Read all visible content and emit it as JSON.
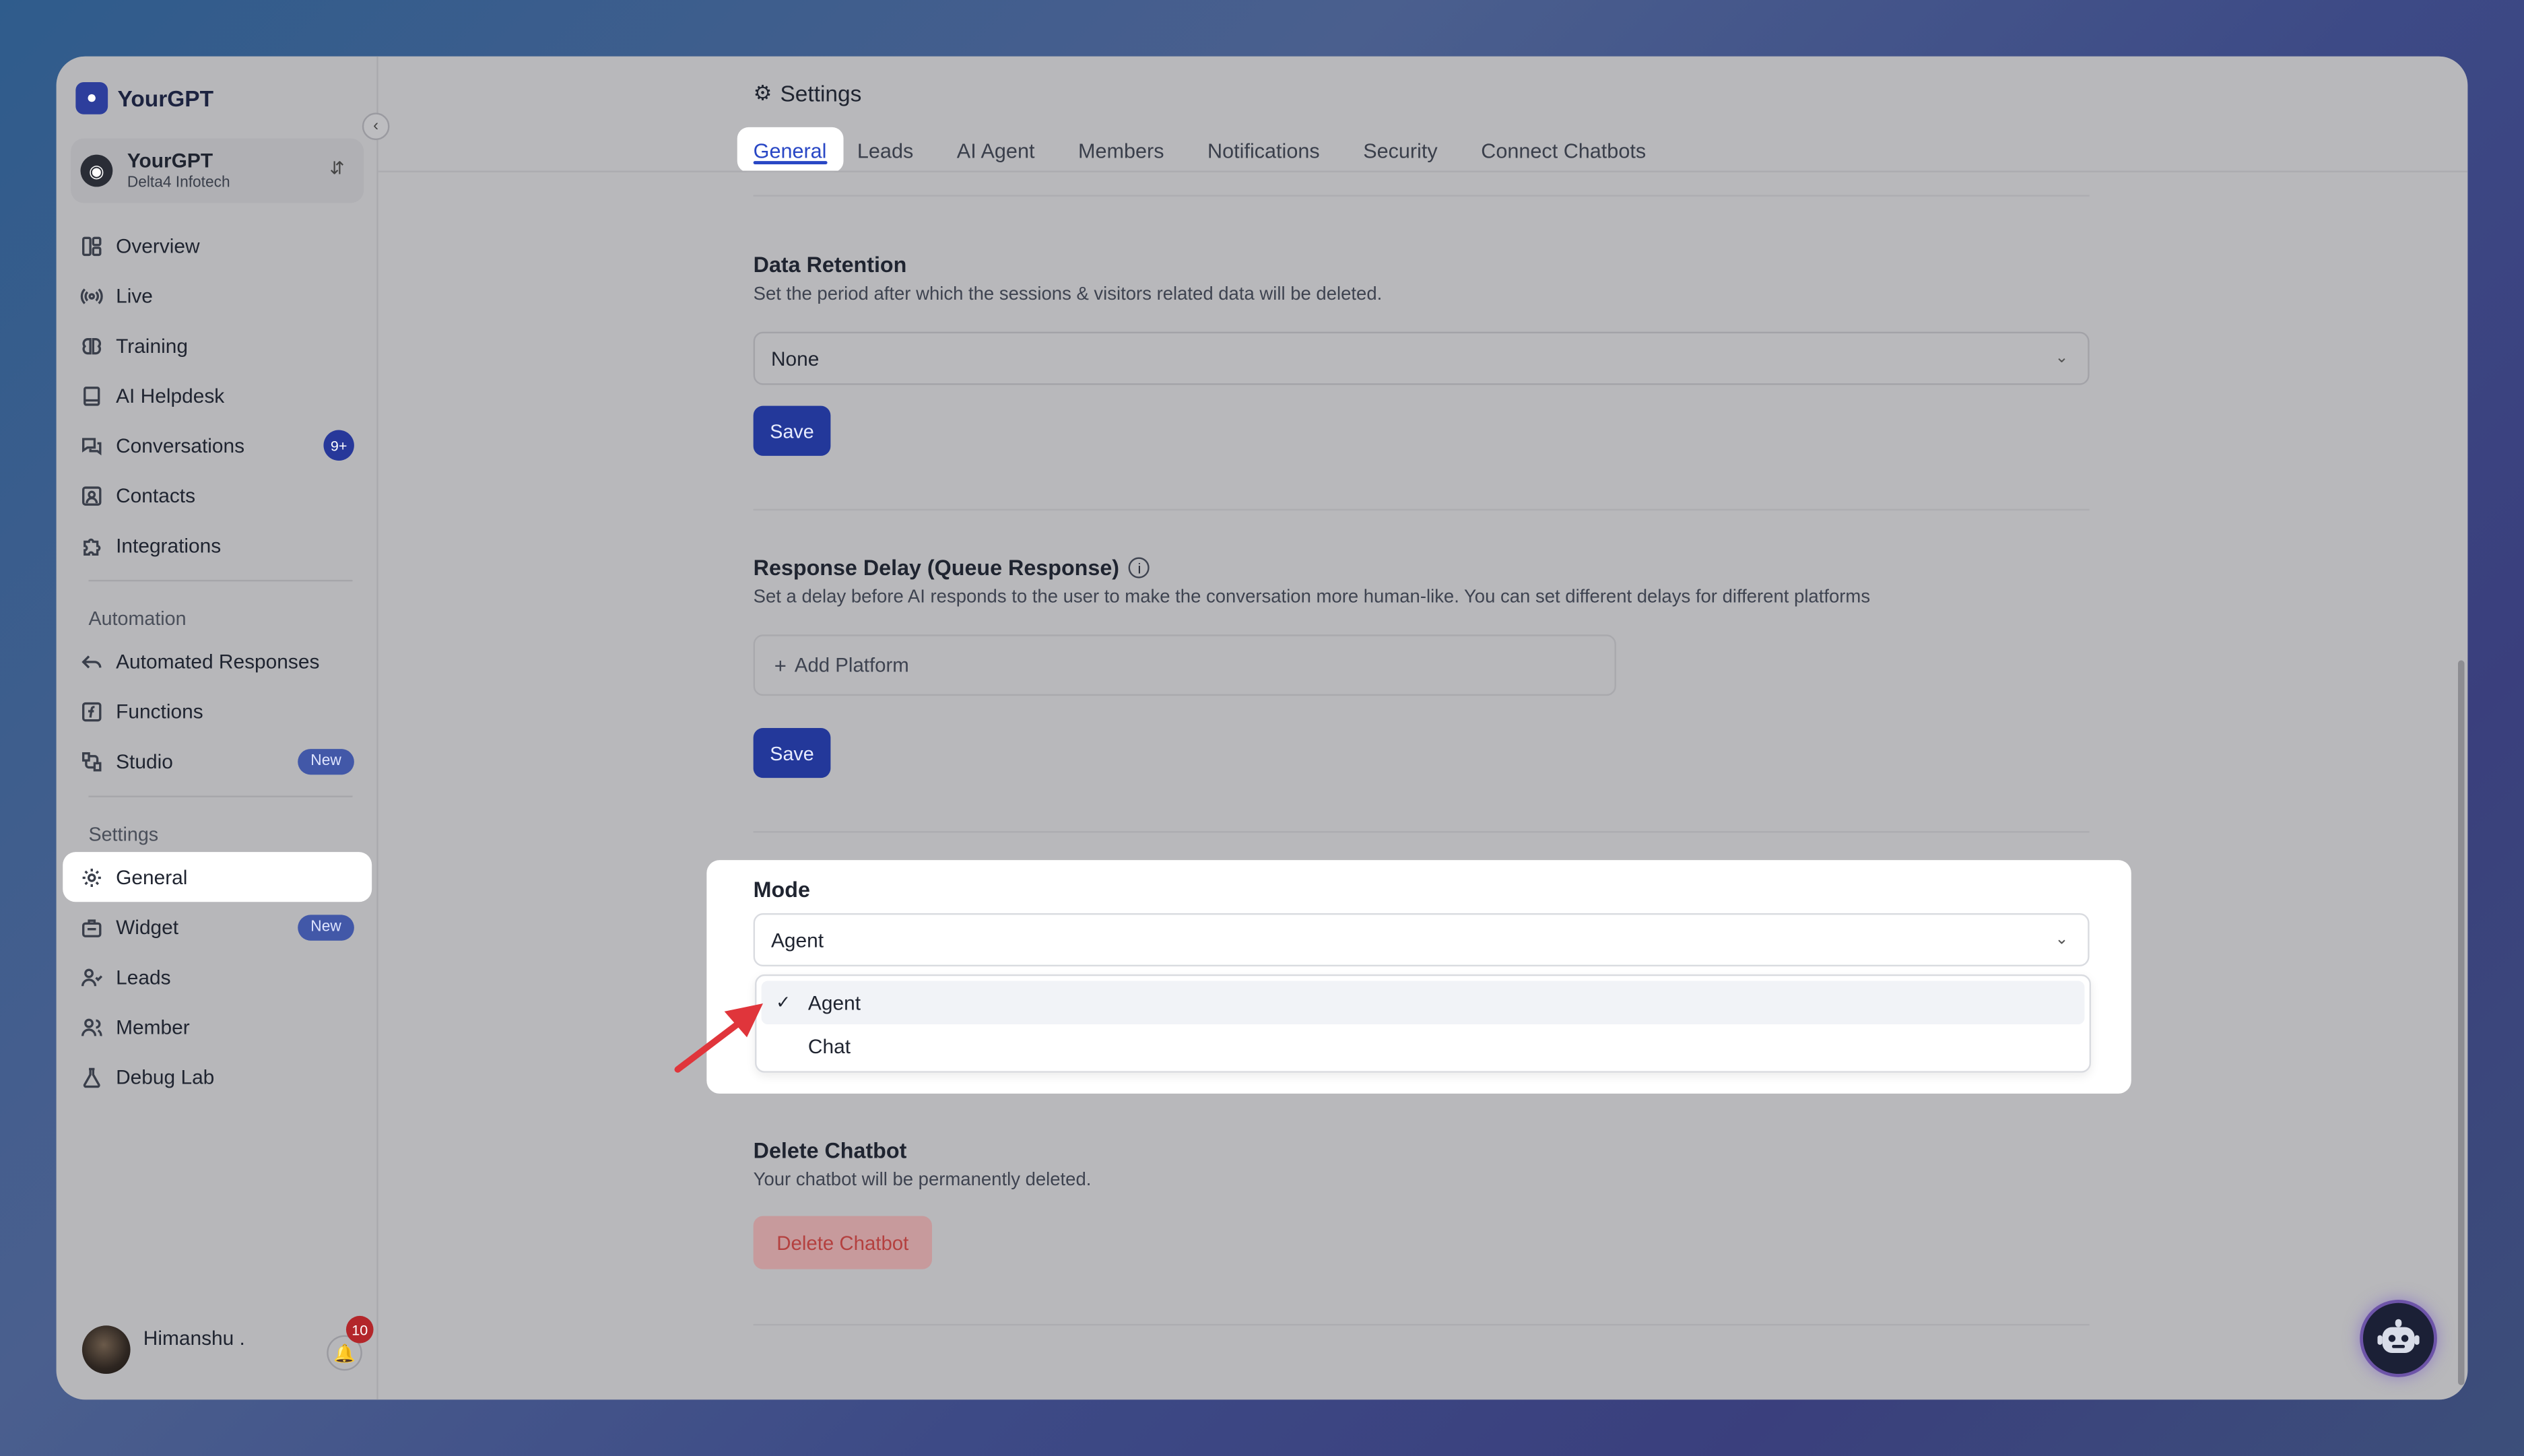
{
  "brand": {
    "name": "YourGPT"
  },
  "workspace": {
    "name": "YourGPT",
    "org": "Delta4 Infotech"
  },
  "sidebar": {
    "primary": [
      {
        "label": "Overview",
        "icon": "layout-icon"
      },
      {
        "label": "Live",
        "icon": "broadcast-icon"
      },
      {
        "label": "Training",
        "icon": "brain-icon"
      },
      {
        "label": "AI Helpdesk",
        "icon": "book-icon"
      },
      {
        "label": "Conversations",
        "icon": "chat-icon",
        "badge": "9+"
      },
      {
        "label": "Contacts",
        "icon": "contact-icon"
      },
      {
        "label": "Integrations",
        "icon": "puzzle-icon"
      }
    ],
    "automation_heading": "Automation",
    "automation": [
      {
        "label": "Automated Responses",
        "icon": "reply-icon"
      },
      {
        "label": "Functions",
        "icon": "function-icon"
      },
      {
        "label": "Studio",
        "icon": "flow-icon",
        "badge": "New"
      }
    ],
    "settings_heading": "Settings",
    "settings": [
      {
        "label": "General",
        "icon": "gear-icon",
        "active": true
      },
      {
        "label": "Widget",
        "icon": "widget-icon",
        "badge": "New"
      },
      {
        "label": "Leads",
        "icon": "user-check-icon"
      },
      {
        "label": "Member",
        "icon": "users-icon"
      },
      {
        "label": "Debug Lab",
        "icon": "flask-icon"
      }
    ]
  },
  "user": {
    "name": "Himanshu .",
    "notifications": "10"
  },
  "header": {
    "title": "Settings",
    "tabs": [
      "General",
      "Leads",
      "AI Agent",
      "Members",
      "Notifications",
      "Security",
      "Connect Chatbots"
    ],
    "active_tab": "General"
  },
  "data_retention": {
    "title": "Data Retention",
    "description": "Set the period after which the sessions & visitors related data will be deleted.",
    "value": "None",
    "save_label": "Save"
  },
  "response_delay": {
    "title": "Response Delay (Queue Response)",
    "description": "Set a delay before AI responds to the user to make the conversation more human-like. You can set different delays for different platforms",
    "add_label": "Add Platform",
    "save_label": "Save"
  },
  "mode": {
    "title": "Mode",
    "value": "Agent",
    "options": [
      "Agent",
      "Chat"
    ],
    "selected": "Agent"
  },
  "delete_chatbot": {
    "title": "Delete Chatbot",
    "description": "Your chatbot will be permanently deleted.",
    "button_label": "Delete Chatbot"
  },
  "colors": {
    "accent": "#2947c5",
    "save_button": "#23389a",
    "delete_text": "#b4403f",
    "arrow": "#e0353b"
  }
}
